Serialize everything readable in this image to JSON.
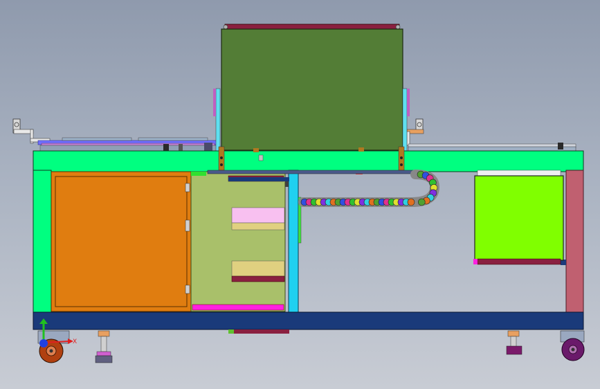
{
  "viewport": {
    "title": ""
  },
  "triad": {
    "x_label": "X",
    "y_label": "Y",
    "colors": {
      "x": "#e02020",
      "y": "#20c020",
      "z": "#2040e0"
    }
  },
  "palette": {
    "frame_green": "#00ff80",
    "base_navy": "#1a3a7a",
    "panel_orange": "#e07d10",
    "panel_olive": "#a9c06a",
    "top_box_green": "#537d36",
    "right_box_green": "#80ff00",
    "leg_rose": "#c06070",
    "post_cyan": "#20d0f0",
    "tray_pink": "#f8c0f0",
    "tray_tan": "#e0d080",
    "background": "#a9b2c1"
  },
  "components": [
    "main-frame-top-beam",
    "left-frame-post",
    "right-frame-leg",
    "base-beam",
    "orange-door-panel",
    "electrical-panel",
    "top-cabinet",
    "right-green-box",
    "cable-drag-chain",
    "caster-wheel-left",
    "caster-wheel-right",
    "leveling-foot-left",
    "leveling-foot-right"
  ]
}
